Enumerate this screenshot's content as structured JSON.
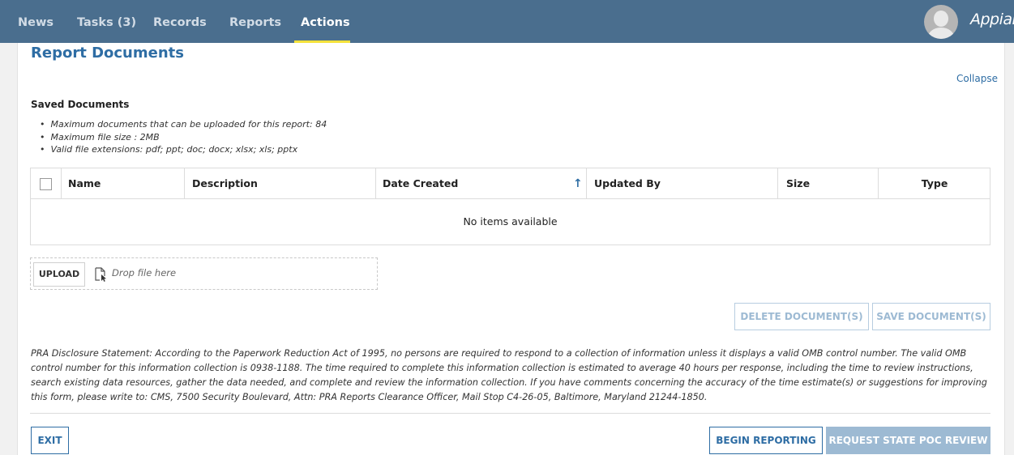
{
  "nav": {
    "tabs": [
      {
        "label": "News"
      },
      {
        "label": "Tasks (3)"
      },
      {
        "label": "Records"
      },
      {
        "label": "Reports"
      },
      {
        "label": "Actions"
      }
    ],
    "active_tab": "Actions",
    "brand": "Appian",
    "colors": {
      "bar": "#4a6e8e",
      "active_underline": "#f4e23c"
    }
  },
  "section": {
    "title": "Report Documents",
    "collapse_label": "Collapse"
  },
  "saved_documents": {
    "title": "Saved Documents",
    "rules": [
      "Maximum documents that can be uploaded for this report: 84",
      "Maximum file size : 2MB",
      "Valid file extensions: pdf; ppt; doc; docx; xlsx; xls; pptx"
    ]
  },
  "grid": {
    "columns": [
      "Name",
      "Description",
      "Date Created",
      "Updated By",
      "Size",
      "Type"
    ],
    "sort_column": "Date Created",
    "sort_direction": "ascending",
    "sort_icon": "arrow-up-icon",
    "empty_message": "No items available"
  },
  "upload": {
    "button_label": "UPLOAD",
    "drop_text": "Drop file here",
    "icon": "file-drop-icon"
  },
  "actions": {
    "delete_label": "DELETE DOCUMENT(S)",
    "save_label": "SAVE DOCUMENT(S)"
  },
  "pra_statement": "PRA Disclosure Statement:  According to the Paperwork Reduction Act of 1995, no persons are required to respond to a collection of information unless it displays a valid OMB control number. The valid OMB control number for this information collection is 0938-1188. The time required to complete this information collection is estimated to average 40 hours per response, including the time to review instructions, search existing data resources, gather the data needed, and complete and review the information collection. If you have comments concerning the accuracy of the time estimate(s) or suggestions for improving this form, please write to: CMS, 7500 Security Boulevard, Attn: PRA Reports Clearance Officer, Mail Stop C4-26-05, Baltimore, Maryland 21244-1850.",
  "footer": {
    "exit_label": "EXIT",
    "begin_reporting_label": "BEGIN REPORTING",
    "request_review_label": "REQUEST STATE POC REVIEW"
  }
}
